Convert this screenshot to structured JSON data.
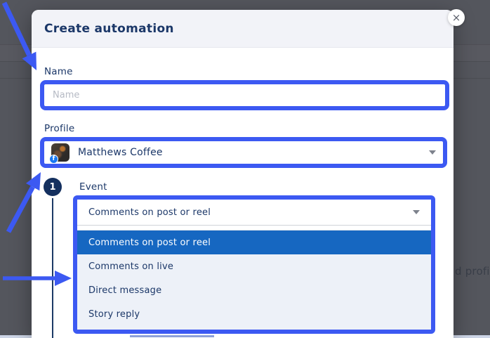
{
  "modal": {
    "title": "Create automation",
    "close_icon": "×",
    "name_field": {
      "label": "Name",
      "placeholder": "Name",
      "value": ""
    },
    "profile_field": {
      "label": "Profile",
      "value": "Matthews Coffee",
      "network": "facebook",
      "badge_letter": "f"
    },
    "event_field": {
      "step_number": "1",
      "label": "Event",
      "selected_value": "Comments on post or reel",
      "options": [
        {
          "label": "Comments on post or reel",
          "selected": true
        },
        {
          "label": "Comments on live",
          "selected": false
        },
        {
          "label": "Direct message",
          "selected": false
        },
        {
          "label": "Story reply",
          "selected": false
        }
      ]
    }
  },
  "background": {
    "clipped_text": "d profi"
  },
  "colors": {
    "annotation_blue": "#3c59f2",
    "selected_option_bg": "#1667c1",
    "navy_text": "#1b3768",
    "facebook_blue": "#1877f2",
    "overlay": "#54565d",
    "listbox_bg": "#edf1f8",
    "header_bg": "#f2f3f8"
  }
}
